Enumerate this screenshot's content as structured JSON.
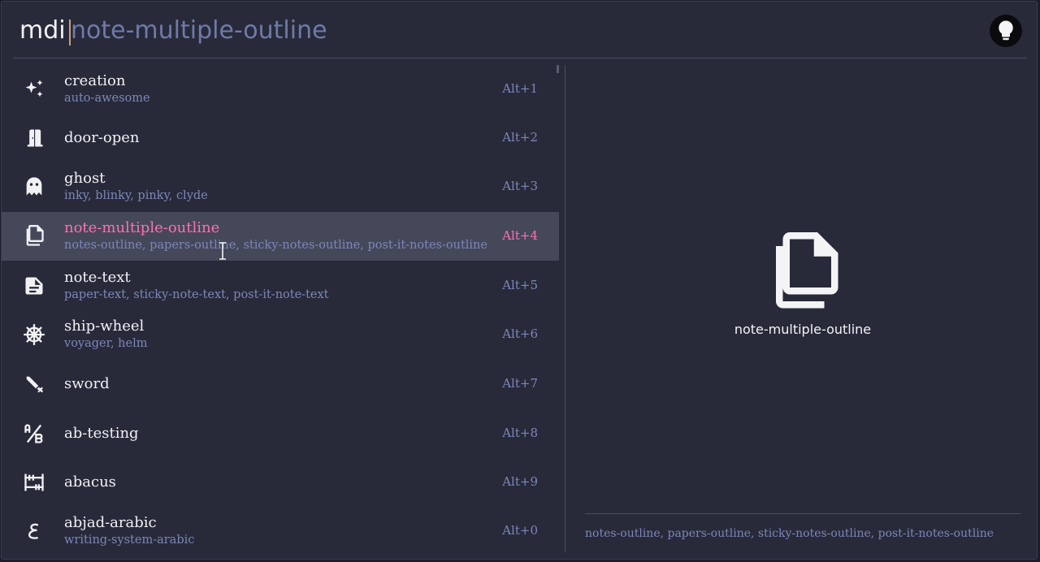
{
  "search": {
    "prefix": "mdi",
    "query": "note-multiple-outline"
  },
  "results": [
    {
      "name": "creation",
      "aliases": "auto-awesome",
      "shortcut": "Alt+1",
      "icon": "creation-icon"
    },
    {
      "name": "door-open",
      "aliases": "",
      "shortcut": "Alt+2",
      "icon": "door-open-icon"
    },
    {
      "name": "ghost",
      "aliases": "inky, blinky, pinky, clyde",
      "shortcut": "Alt+3",
      "icon": "ghost-icon"
    },
    {
      "name": "note-multiple-outline",
      "aliases": "notes-outline, papers-outline, sticky-notes-outline, post-it-notes-outline",
      "shortcut": "Alt+4",
      "icon": "note-multiple-outline-icon",
      "selected": true
    },
    {
      "name": "note-text",
      "aliases": "paper-text, sticky-note-text, post-it-note-text",
      "shortcut": "Alt+5",
      "icon": "note-text-icon"
    },
    {
      "name": "ship-wheel",
      "aliases": "voyager, helm",
      "shortcut": "Alt+6",
      "icon": "ship-wheel-icon"
    },
    {
      "name": "sword",
      "aliases": "",
      "shortcut": "Alt+7",
      "icon": "sword-icon"
    },
    {
      "name": "ab-testing",
      "aliases": "",
      "shortcut": "Alt+8",
      "icon": "ab-testing-icon"
    },
    {
      "name": "abacus",
      "aliases": "",
      "shortcut": "Alt+9",
      "icon": "abacus-icon"
    },
    {
      "name": "abjad-arabic",
      "aliases": "writing-system-arabic",
      "shortcut": "Alt+0",
      "icon": "abjad-arabic-icon"
    }
  ],
  "preview": {
    "name": "note-multiple-outline",
    "aliases": "notes-outline, papers-outline, sticky-notes-outline, post-it-notes-outline",
    "icon": "note-multiple-outline-icon"
  },
  "colors": {
    "background": "#282a3a",
    "selected_row": "#454859",
    "accent_pink": "#ff6fb4",
    "muted_blue": "#7d87b8"
  }
}
